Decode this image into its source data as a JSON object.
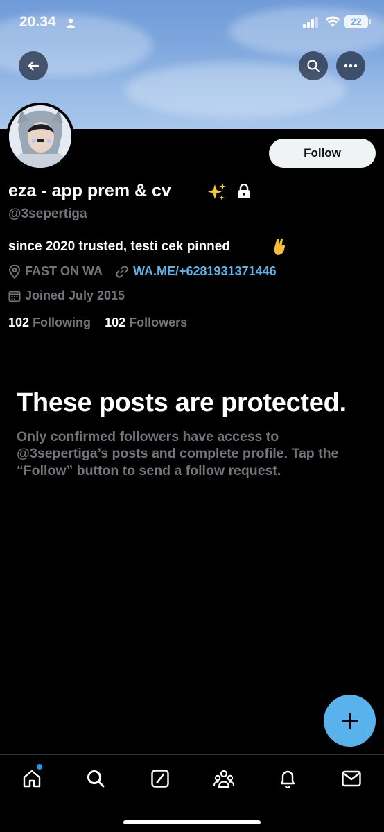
{
  "status_bar": {
    "time": "20.34",
    "battery": "22"
  },
  "header": {
    "back_icon": "arrow-left-icon",
    "search_icon": "search-icon",
    "more_icon": "more-horizontal-icon"
  },
  "profile": {
    "follow_label": "Follow",
    "display_name": "eza - app prem & cv",
    "handle": "@3sepertiga",
    "bio": "since 2020 trusted, testi cek pinned",
    "location": "FAST ON WA",
    "website": "WA.ME/+6281931371446",
    "joined": "Joined July 2015",
    "following_count": "102",
    "following_label": "Following",
    "followers_count": "102",
    "followers_label": "Followers"
  },
  "protected": {
    "title": "These posts are protected.",
    "body": "Only confirmed followers have access to @3sepertiga’s posts and complete profile. Tap the “Follow” button to send a follow request."
  },
  "fab": {
    "icon": "plus-icon"
  },
  "bottom_nav": {
    "items": [
      "home-icon",
      "search-icon",
      "grok-icon",
      "communities-icon",
      "notifications-icon",
      "messages-icon"
    ]
  },
  "colors": {
    "background": "#000000",
    "accent": "#1d9bf0",
    "link": "#5fb2e6",
    "muted_text": "#71767b",
    "fab": "#5ab2ec",
    "follow_button": "#eff3f4"
  }
}
